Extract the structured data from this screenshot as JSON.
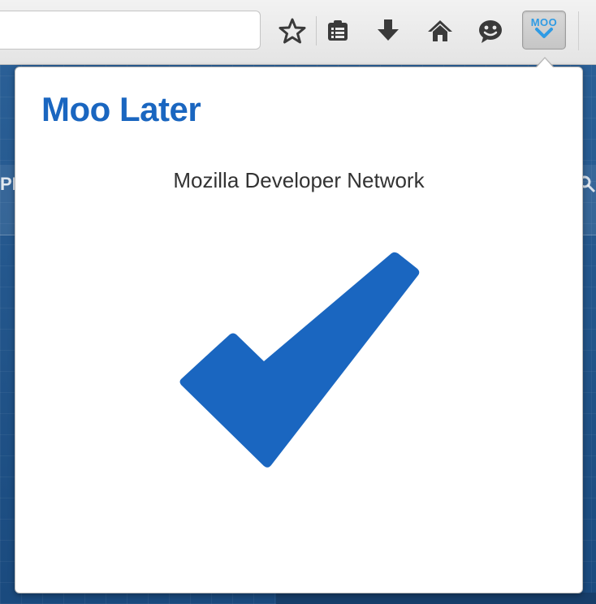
{
  "toolbar": {
    "icons": [
      "bookmark-star-icon",
      "reading-list-icon",
      "downloads-icon",
      "home-icon",
      "emoji-smiley-icon"
    ],
    "extension_button": {
      "label": "MOO",
      "icon": "chevron-down-icon",
      "accent": "#2f9be4"
    }
  },
  "page_behind": {
    "partial_text": "PE",
    "icon": "search-icon"
  },
  "popup": {
    "title": "Moo Later",
    "site_name": "Mozilla Developer Network",
    "status_icon": "checkmark-icon",
    "accent": "#1a66c0"
  }
}
